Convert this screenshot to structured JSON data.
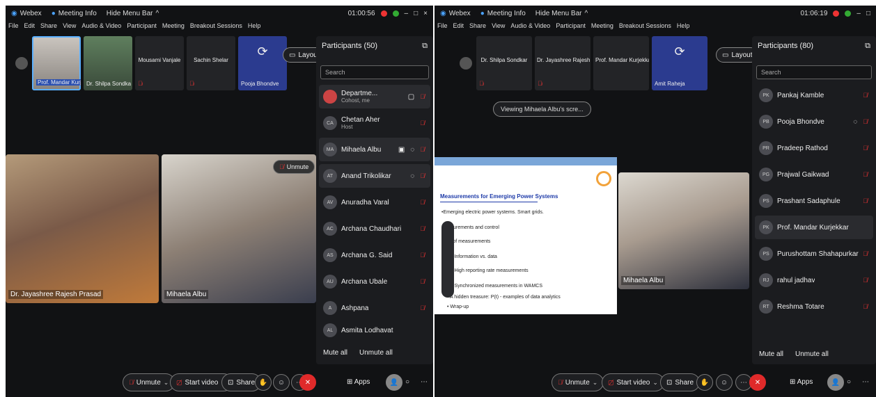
{
  "left": {
    "titlebar": {
      "app": "Webex",
      "info": "Meeting Info",
      "hide_menu": "Hide Menu Bar",
      "caret": "^",
      "timer": "01:00:56"
    },
    "menu": [
      "File",
      "Edit",
      "Share",
      "View",
      "Audio & Video",
      "Participant",
      "Meeting",
      "Breakout Sessions",
      "Help"
    ],
    "thumbs": [
      {
        "name": "Prof. Mandar Kurjekkar"
      },
      {
        "name": "Dr. Shilpa Sondkar"
      },
      {
        "name": "Mousami Vanjale"
      },
      {
        "name": "Sachin Shelar"
      },
      {
        "name": "Pooja Bhondve"
      }
    ],
    "layout_label": "Layout",
    "videos": {
      "v1_name": "Dr. Jayashree Rajesh Prasad",
      "v2_name": "Mihaela Albu",
      "unmute": "Unmute"
    },
    "panel": {
      "title": "Participants (50)",
      "search": "Search",
      "rows": [
        {
          "name": "Departme...",
          "sub": "Cohost, me"
        },
        {
          "name": "Chetan Aher",
          "sub": "Host",
          "initials": "CA"
        },
        {
          "name": "Mihaela Albu",
          "initials": "MA"
        },
        {
          "name": "Anand Trikolikar",
          "initials": "AT"
        },
        {
          "name": "Anuradha Varal",
          "initials": "AV"
        },
        {
          "name": "Archana Chaudhari",
          "initials": "AC"
        },
        {
          "name": "Archana G. Said",
          "initials": "AS"
        },
        {
          "name": "Archana Ubale",
          "initials": "AU"
        },
        {
          "name": "Ashpana",
          "initials": "A"
        },
        {
          "name": "Asmita Lodhavat",
          "initials": "AL"
        }
      ],
      "mute_all": "Mute all",
      "unmute_all": "Unmute all"
    },
    "bottom": {
      "unmute": "Unmute",
      "start_video": "Start video",
      "share": "Share",
      "apps": "Apps"
    }
  },
  "right": {
    "titlebar": {
      "app": "Webex",
      "info": "Meeting Info",
      "hide_menu": "Hide Menu Bar",
      "caret": "^",
      "timer": "01:06:19"
    },
    "menu": [
      "File",
      "Edit",
      "Share",
      "View",
      "Audio & Video",
      "Participant",
      "Meeting",
      "Breakout Sessions",
      "Help"
    ],
    "thumbs": [
      {
        "name": "Dr. Shilpa Sondkar"
      },
      {
        "name": "Dr. Jayashree Rajesh Pra..."
      },
      {
        "name": "Prof. Mandar Kurjekkar"
      },
      {
        "name": "Amit Raheja"
      }
    ],
    "layout_label": "Layout",
    "viewing": "Viewing Mihaela Albu's scre...",
    "slide": {
      "title": "Measurements for Emerging Power Systems",
      "bullets": [
        "•Emerging electric power systems. Smart grids.",
        "Measurements and control",
        "Role of measurements",
        "•Information vs. data",
        "•High reporting rate measurements",
        "•Synchronized measurements in WAMCS",
        "• A hidden treasure: P(t) - examples of data analytics",
        "• Wrap-up"
      ]
    },
    "video_name": "Mihaela Albu",
    "panel": {
      "title": "Participants (80)",
      "search": "Search",
      "rows": [
        {
          "name": "Pankaj Kamble",
          "initials": "PK"
        },
        {
          "name": "Pooja Bhondve",
          "initials": "PB"
        },
        {
          "name": "Pradeep Rathod",
          "initials": "PR"
        },
        {
          "name": "Prajwal Gaikwad",
          "initials": "PG"
        },
        {
          "name": "Prashant Sadaphule",
          "initials": "PS"
        },
        {
          "name": "Prof. Mandar Kurjekkar",
          "initials": "PK"
        },
        {
          "name": "Purushottam Shahapurkar",
          "initials": "PS"
        },
        {
          "name": "rahul jadhav",
          "initials": "RJ"
        },
        {
          "name": "Reshma Totare",
          "initials": "RT"
        }
      ],
      "mute_all": "Mute all",
      "unmute_all": "Unmute all"
    },
    "bottom": {
      "unmute": "Unmute",
      "start_video": "Start video",
      "share": "Share",
      "apps": "Apps"
    }
  },
  "colors": {
    "end_call": "#e02a2a",
    "muted": "#e33333",
    "bg": "#111214"
  }
}
